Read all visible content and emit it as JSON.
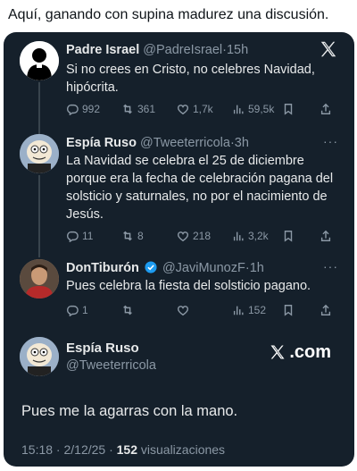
{
  "caption": "Aquí, ganando con supina madurez una discusión.",
  "posts": [
    {
      "name": "Padre Israel",
      "handle": "@PadreIsrael",
      "sep": "·",
      "time": "15h",
      "text": "Si no crees en Cristo, no celebres Navidad, hipócrita.",
      "replies": "992",
      "reposts": "361",
      "likes": "1,7k",
      "views": "59,5k"
    },
    {
      "name": "Espía Ruso",
      "handle": "@Tweeterricola",
      "sep": "·",
      "time": "3h",
      "text": "La Navidad se celebra el 25 de diciembre porque era la fecha de celebración pagana del solsticio y saturnales, no por el nacimiento de Jesús.",
      "replies": "11",
      "reposts": "8",
      "likes": "218",
      "views": "3,2k"
    },
    {
      "name": "DonTiburón",
      "handle": "@JaviMunozF",
      "sep": "·",
      "time": "1h",
      "text": "Pues celebra la fiesta del solsticio pagano.",
      "replies": "1",
      "reposts": "",
      "likes": "",
      "views": "152"
    }
  ],
  "final": {
    "name": "Espía Ruso",
    "handle": "@Tweeterricola",
    "text": "Pues me la agarras con la mano.",
    "date": "15:18 · 2/12/25 · ",
    "views_count": "152",
    "views_label": " visualizaciones"
  },
  "brand": {
    "xcom": ".com"
  },
  "colors": {
    "card_bg": "#15202b",
    "text": "#e7e9ea",
    "muted": "#8b98a5",
    "verified": "#1d9bf0"
  }
}
